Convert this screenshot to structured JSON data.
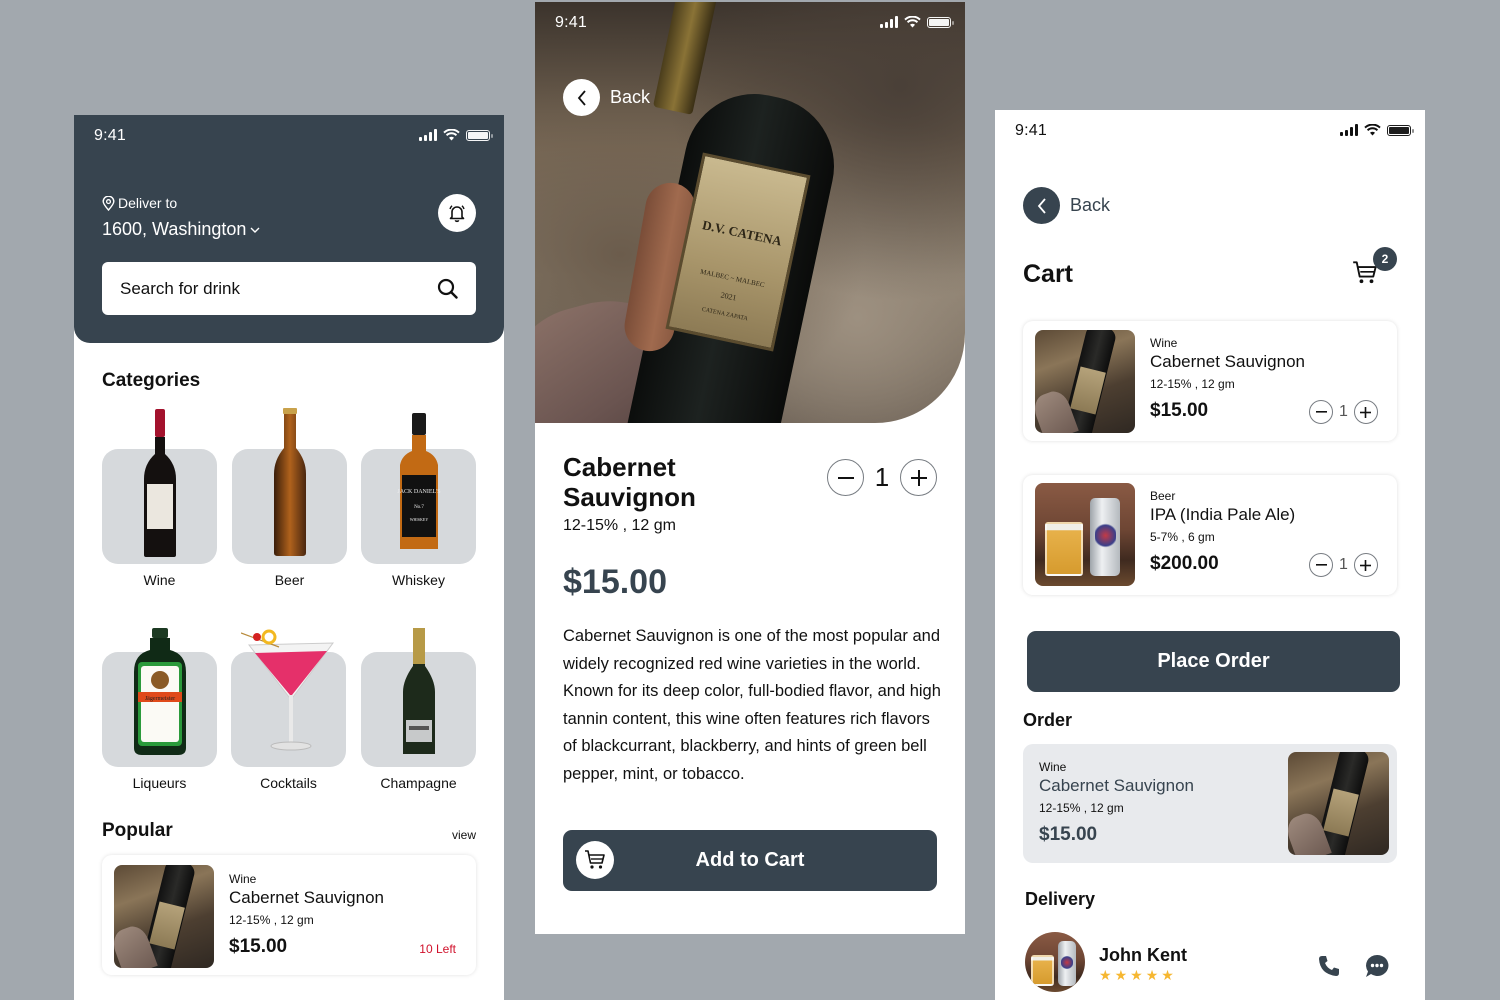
{
  "status_bar": {
    "time": "9:41"
  },
  "home": {
    "deliver_label": "Deliver to",
    "address": "1600, Washington",
    "search_placeholder": "Search for drink",
    "categories_title": "Categories",
    "categories": [
      {
        "label": "Wine",
        "icon": "wine-bottle-icon"
      },
      {
        "label": "Beer",
        "icon": "beer-bottle-icon"
      },
      {
        "label": "Whiskey",
        "icon": "whiskey-bottle-icon"
      },
      {
        "label": "Liqueurs",
        "icon": "liqueur-bottle-icon"
      },
      {
        "label": "Cocktails",
        "icon": "cocktail-glass-icon"
      },
      {
        "label": "Champagne",
        "icon": "champagne-bottle-icon"
      }
    ],
    "popular_title": "Popular",
    "view_label": "view",
    "popular_item": {
      "category": "Wine",
      "name": "Cabernet Sauvignon",
      "spec": "12-15% , 12 gm",
      "price": "$15.00",
      "stock": "10 Left"
    }
  },
  "detail": {
    "back_label": "Back",
    "name": "Cabernet Sauvignon",
    "spec": "12-15% , 12 gm",
    "price": "$15.00",
    "quantity": "1",
    "hero_label": {
      "brand": "D.V. CATENA",
      "variety": "MALBEC ~ MALBEC",
      "year": "2021",
      "vineyard": "CATENA ZAPATA"
    },
    "description": "Cabernet Sauvignon is one of the most popular and widely recognized red wine varieties in the world. Known for its deep color, full-bodied flavor, and high tannin content, this wine often features rich flavors of blackcurrant, blackberry, and hints of green bell pepper, mint, or tobacco.",
    "add_to_cart_label": "Add to Cart"
  },
  "cart": {
    "back_label": "Back",
    "title": "Cart",
    "badge_count": "2",
    "items": [
      {
        "category": "Wine",
        "name": "Cabernet Sauvignon",
        "spec": "12-15% , 12 gm",
        "price": "$15.00",
        "quantity": "1"
      },
      {
        "category": "Beer",
        "name": "IPA (India Pale Ale)",
        "spec": "5-7% , 6 gm",
        "price": "$200.00",
        "quantity": "1"
      }
    ],
    "place_order_label": "Place Order",
    "order_title": "Order",
    "order_item": {
      "category": "Wine",
      "name": "Cabernet Sauvignon",
      "spec": "12-15% , 12 gm",
      "price": "$15.00"
    },
    "delivery_title": "Delivery",
    "courier": {
      "name": "John Kent",
      "rating": 5,
      "rating_max": 5
    },
    "colors": {
      "primary": "#37444f",
      "star": "#f6b731",
      "stock_alert": "#d0112b",
      "background": "#a2a8ae"
    }
  }
}
